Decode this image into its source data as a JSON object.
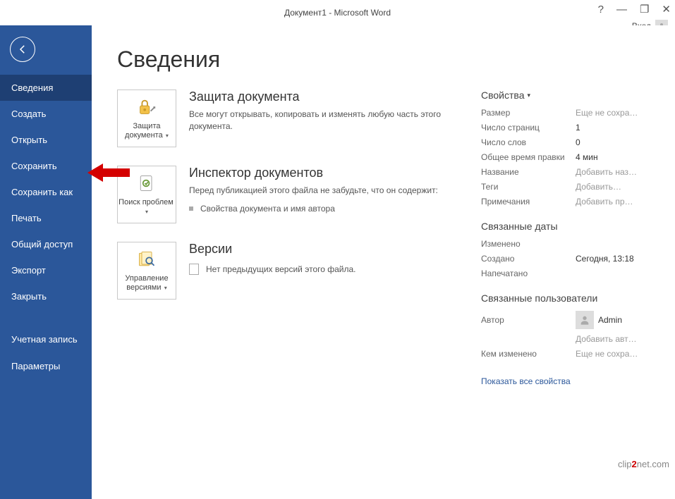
{
  "window": {
    "title": "Документ1 - Microsoft Word",
    "help_icon": "?",
    "minimize_icon": "—",
    "restore_icon": "❐",
    "close_icon": "✕",
    "signin_label": "Вход"
  },
  "sidebar": {
    "items": [
      "Сведения",
      "Создать",
      "Открыть",
      "Сохранить",
      "Сохранить как",
      "Печать",
      "Общий доступ",
      "Экспорт",
      "Закрыть",
      "Учетная запись",
      "Параметры"
    ]
  },
  "page": {
    "title": "Сведения",
    "protect": {
      "tile": "Защита документа",
      "heading": "Защита документа",
      "text": "Все могут открывать, копировать и изменять любую часть этого документа."
    },
    "inspect": {
      "tile": "Поиск проблем",
      "heading": "Инспектор документов",
      "text": "Перед публикацией этого файла не забудьте, что он содержит:",
      "bullet": "Свойства документа и имя автора"
    },
    "versions": {
      "tile": "Управление версиями",
      "heading": "Версии",
      "text": "Нет предыдущих версий этого файла."
    }
  },
  "props": {
    "header": "Свойства",
    "rows": {
      "size_label": "Размер",
      "size_value": "Еще не сохра…",
      "pages_label": "Число страниц",
      "pages_value": "1",
      "words_label": "Число слов",
      "words_value": "0",
      "edit_label": "Общее время правки",
      "edit_value": "4 мин",
      "title_label": "Название",
      "title_value": "Добавить наз…",
      "tags_label": "Теги",
      "tags_value": "Добавить…",
      "notes_label": "Примечания",
      "notes_value": "Добавить пр…"
    },
    "dates_header": "Связанные даты",
    "dates": {
      "modified_label": "Изменено",
      "modified_value": "",
      "created_label": "Создано",
      "created_value": "Сегодня, 13:18",
      "printed_label": "Напечатано",
      "printed_value": ""
    },
    "people_header": "Связанные пользователи",
    "author_label": "Автор",
    "author_name": "Admin",
    "add_author": "Добавить авт…",
    "changed_by_label": "Кем изменено",
    "changed_by_value": "Еще не сохра…",
    "show_all": "Показать все свойства"
  },
  "watermark": {
    "pre": "clip",
    "mid": "2",
    "post": "net.com"
  }
}
